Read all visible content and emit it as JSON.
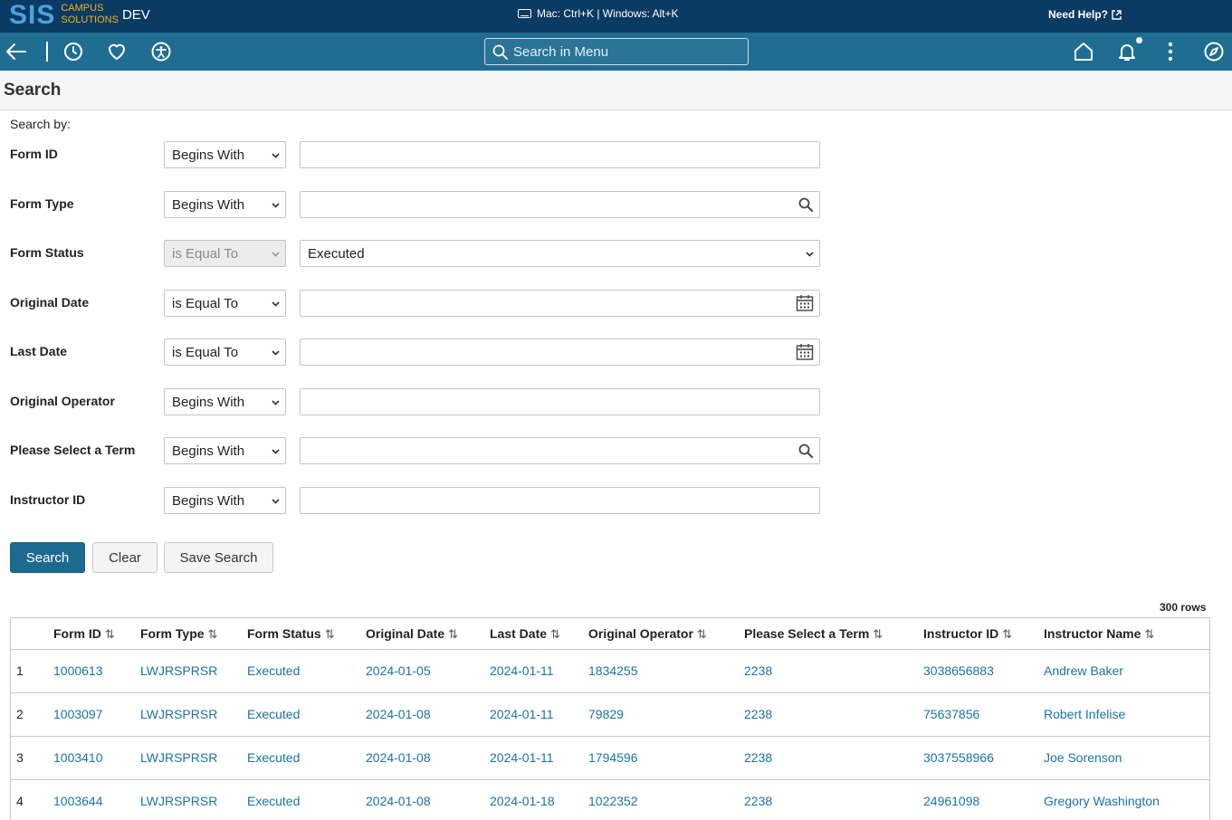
{
  "brand": {
    "logo_main": "SIS",
    "logo_sub_1": "CAMPUS",
    "logo_sub_2": "SOLUTIONS",
    "environment": "DEV",
    "shortcut_hint": "Mac: Ctrl+K | Windows: Alt+K",
    "need_help": "Need Help?"
  },
  "nav": {
    "back_icon": "back-arrow-icon",
    "recent_icon": "clock-icon",
    "favorites_icon": "heart-icon",
    "accessibility_icon": "accessibility-icon",
    "search_placeholder": "Search in Menu",
    "home_icon": "home-icon",
    "notifications_icon": "bell-icon",
    "actions_icon": "kebab-icon",
    "navigator_icon": "compass-icon"
  },
  "page": {
    "title": "Search",
    "search_by": "Search by:"
  },
  "criteria": [
    {
      "label": "Form ID",
      "operator": "Begins With",
      "value": "",
      "kind": "text",
      "disabled": false
    },
    {
      "label": "Form Type",
      "operator": "Begins With",
      "value": "",
      "kind": "lookup",
      "disabled": false
    },
    {
      "label": "Form Status",
      "operator": "is Equal To",
      "value": "Executed",
      "kind": "select",
      "disabled": true
    },
    {
      "label": "Original Date",
      "operator": "is Equal To",
      "value": "",
      "kind": "date",
      "disabled": false
    },
    {
      "label": "Last Date",
      "operator": "is Equal To",
      "value": "",
      "kind": "date",
      "disabled": false
    },
    {
      "label": "Original Operator",
      "operator": "Begins With",
      "value": "",
      "kind": "text",
      "disabled": false
    },
    {
      "label": "Please Select a Term",
      "operator": "Begins With",
      "value": "",
      "kind": "lookup",
      "disabled": false
    },
    {
      "label": "Instructor ID",
      "operator": "Begins With",
      "value": "",
      "kind": "text",
      "disabled": false
    }
  ],
  "buttons": {
    "search": "Search",
    "clear": "Clear",
    "save_search": "Save Search"
  },
  "results": {
    "row_count": "300 rows",
    "sort_glyph": "⇅",
    "columns": [
      "Form ID",
      "Form Type",
      "Form Status",
      "Original Date",
      "Last Date",
      "Original Operator",
      "Please Select a Term",
      "Instructor ID",
      "Instructor Name"
    ],
    "rows": [
      [
        "1",
        "1000613",
        "LWJRSPRSR",
        "Executed",
        "2024-01-05",
        "2024-01-11",
        "1834255",
        "2238",
        "3038656883",
        "Andrew Baker"
      ],
      [
        "2",
        "1003097",
        "LWJRSPRSR",
        "Executed",
        "2024-01-08",
        "2024-01-11",
        "79829",
        "2238",
        "75637856",
        "Robert Infelise"
      ],
      [
        "3",
        "1003410",
        "LWJRSPRSR",
        "Executed",
        "2024-01-08",
        "2024-01-11",
        "1794596",
        "2238",
        "3037558966",
        "Joe Sorenson"
      ],
      [
        "4",
        "1003644",
        "LWJRSPRSR",
        "Executed",
        "2024-01-08",
        "2024-01-18",
        "1022352",
        "2238",
        "24961098",
        "Gregory Washington"
      ]
    ]
  },
  "colors": {
    "brand_bar": "#0b3a63",
    "nav_bar": "#1f6e91",
    "primary_button": "#1d6a91",
    "link": "#1a73a8",
    "logo_blue": "#4aa3df",
    "logo_gold": "#f0b323"
  }
}
